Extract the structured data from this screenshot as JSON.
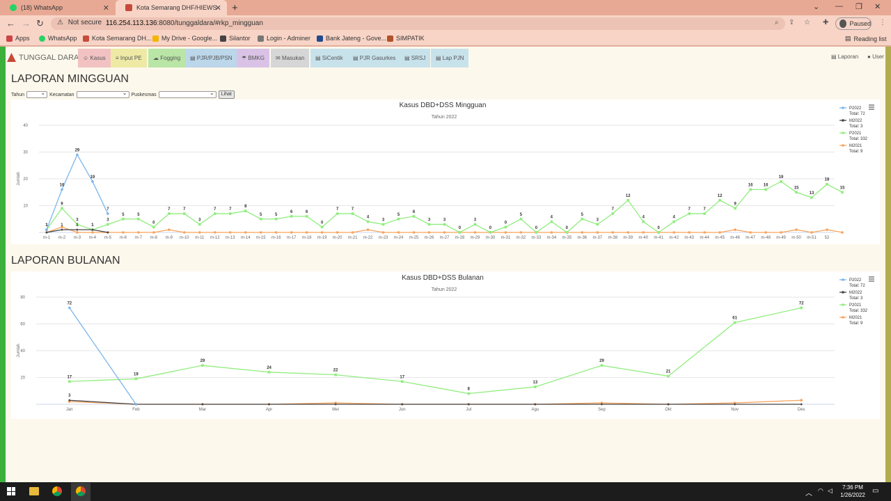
{
  "browser": {
    "tabs": [
      {
        "label": "(18) WhatsApp",
        "active": false
      },
      {
        "label": "Kota Semarang DHF/HIEWS",
        "active": true
      }
    ],
    "security": "Not secure",
    "url_host": "116.254.113.136",
    "url_rest": ":8080/tunggaldara/#rkp_mingguan",
    "profile": "Paused",
    "bookmarks": [
      "Apps",
      "WhatsApp",
      "Kota Semarang DH...",
      "My Drive - Google...",
      "Silantor",
      "Login - Adminer",
      "Bank Jateng - Gove...",
      "SIMPATIK"
    ],
    "reading_list": "Reading list"
  },
  "app": {
    "brand": "TUNGGAL DARA",
    "menu": [
      {
        "label": "Kasus",
        "color": "#f2c2c2"
      },
      {
        "label": "Input PE",
        "color": "#eeeaa6"
      },
      {
        "label": "Fogging",
        "color": "#b9e6a6"
      },
      {
        "label": "PJR/PJB/PSN",
        "color": "#bcd6ea"
      },
      {
        "label": "BMKG",
        "color": "#d9c2e6"
      },
      {
        "label": "Masukan",
        "color": "#d6d6d6"
      },
      {
        "label": "SiCentik",
        "color": "#c8e2ec"
      },
      {
        "label": "PJR Gasurkes",
        "color": "#c8e2ec"
      },
      {
        "label": "SRSJ",
        "color": "#c8e2ec"
      },
      {
        "label": "Lap PJN",
        "color": "#c8e2ec"
      }
    ],
    "laporan": "Laporan",
    "user": "User"
  },
  "weekly": {
    "section_title": "LAPORAN MINGGUAN",
    "filter": {
      "tahun": "Tahun",
      "kecamatan": "Kecamatan",
      "puskesmas": "Puskesmas",
      "button": "Lihat"
    }
  },
  "monthly": {
    "section_title": "LAPORAN BULANAN"
  },
  "chart_data": [
    {
      "type": "line",
      "title": "Kasus DBD+DSS Mingguan",
      "subtitle": "Tahun 2022",
      "ylabel": "Jumlah",
      "ylim": [
        0,
        40
      ],
      "yticks": [
        10,
        20,
        30,
        40
      ],
      "categories": [
        "m-1",
        "m-2",
        "m-3",
        "m-4",
        "m-5",
        "m-6",
        "m-7",
        "m-8",
        "m-9",
        "m-10",
        "m-11",
        "m-12",
        "m-13",
        "m-14",
        "m-15",
        "m-16",
        "m-17",
        "m-18",
        "m-19",
        "m-20",
        "m-21",
        "m-22",
        "m-23",
        "m-24",
        "m-25",
        "m-26",
        "m-27",
        "m-28",
        "m-29",
        "m-30",
        "m-31",
        "m-32",
        "m-33",
        "m-34",
        "m-35",
        "m-36",
        "m-37",
        "m-38",
        "m-39",
        "m-40",
        "m-41",
        "m-42",
        "m-43",
        "m-44",
        "m-45",
        "m-46",
        "m-47",
        "m-48",
        "m-49",
        "m-50",
        "m-51",
        "52"
      ],
      "series": [
        {
          "name": "P2022",
          "total": "Total: 72",
          "color": "#7cb5ec",
          "values": [
            1,
            16,
            29,
            19,
            7
          ]
        },
        {
          "name": "M2022",
          "total": "Total: 3",
          "color": "#434348",
          "values": [
            0,
            1,
            1,
            1,
            0
          ]
        },
        {
          "name": "P2021",
          "total": "Total: 332",
          "color": "#90ed7d",
          "values": [
            1,
            9,
            3,
            1,
            3,
            5,
            5,
            2,
            7,
            7,
            3,
            7,
            7,
            8,
            5,
            5,
            6,
            6,
            2,
            7,
            7,
            4,
            3,
            5,
            6,
            3,
            3,
            0,
            3,
            0,
            2,
            5,
            0,
            4,
            0,
            5,
            3,
            7,
            12,
            4,
            0,
            4,
            7,
            7,
            12,
            9,
            16,
            16,
            19,
            15,
            13,
            18,
            15
          ]
        },
        {
          "name": "M2021",
          "total": "Total: 9",
          "color": "#f7a35c",
          "values": [
            0,
            2,
            0,
            0,
            0,
            0,
            0,
            0,
            1,
            0,
            0,
            0,
            0,
            0,
            0,
            0,
            0,
            0,
            0,
            0,
            0,
            1,
            0,
            0,
            0,
            0,
            0,
            0,
            0,
            0,
            0,
            0,
            0,
            0,
            0,
            0,
            0,
            0,
            0,
            0,
            0,
            0,
            0,
            0,
            0,
            1,
            0,
            0,
            0,
            1,
            0,
            1,
            0
          ]
        }
      ],
      "p2021_labels": [
        "1",
        "9",
        "3",
        "1",
        "3",
        "5",
        "5",
        "0",
        "7",
        "7",
        "3",
        "7",
        "7",
        "8",
        "5",
        "5",
        "6",
        "6",
        "0",
        "7",
        "7",
        "4",
        "3",
        "5",
        "6",
        "3",
        "3",
        "0",
        "3",
        "0",
        "0",
        "5",
        "0",
        "4",
        "0",
        "5",
        "3",
        "7",
        "12",
        "4",
        "0",
        "4",
        "7",
        "7",
        "12",
        "9",
        "16",
        "16",
        "19",
        "15",
        "13",
        "18",
        "15"
      ]
    },
    {
      "type": "line",
      "title": "Kasus DBD+DSS Bulanan",
      "subtitle": "Tahun 2022",
      "ylabel": "Jumlah",
      "ylim": [
        0,
        80
      ],
      "yticks": [
        20,
        40,
        60,
        80
      ],
      "categories": [
        "Jan",
        "Feb",
        "Mar",
        "Apr",
        "Mei",
        "Jun",
        "Jul",
        "Agu",
        "Sep",
        "Okt",
        "Nov",
        "Des"
      ],
      "series": [
        {
          "name": "P2022",
          "total": "Total: 72",
          "color": "#7cb5ec",
          "values": [
            72,
            0
          ]
        },
        {
          "name": "M2022",
          "total": "Total: 3",
          "color": "#434348",
          "values": [
            3,
            0,
            0,
            0,
            0,
            0,
            0,
            0,
            0,
            0,
            0,
            0
          ]
        },
        {
          "name": "P2021",
          "total": "Total: 332",
          "color": "#90ed7d",
          "values": [
            17,
            19,
            29,
            24,
            22,
            17,
            8,
            13,
            29,
            21,
            61,
            72
          ]
        },
        {
          "name": "M2021",
          "total": "Total: 9",
          "color": "#f7a35c",
          "values": [
            2,
            0,
            0,
            0,
            1,
            0,
            0,
            0,
            1,
            0,
            1,
            3
          ]
        }
      ]
    }
  ],
  "taskbar": {
    "time": "7:36 PM",
    "date": "1/26/2022"
  }
}
